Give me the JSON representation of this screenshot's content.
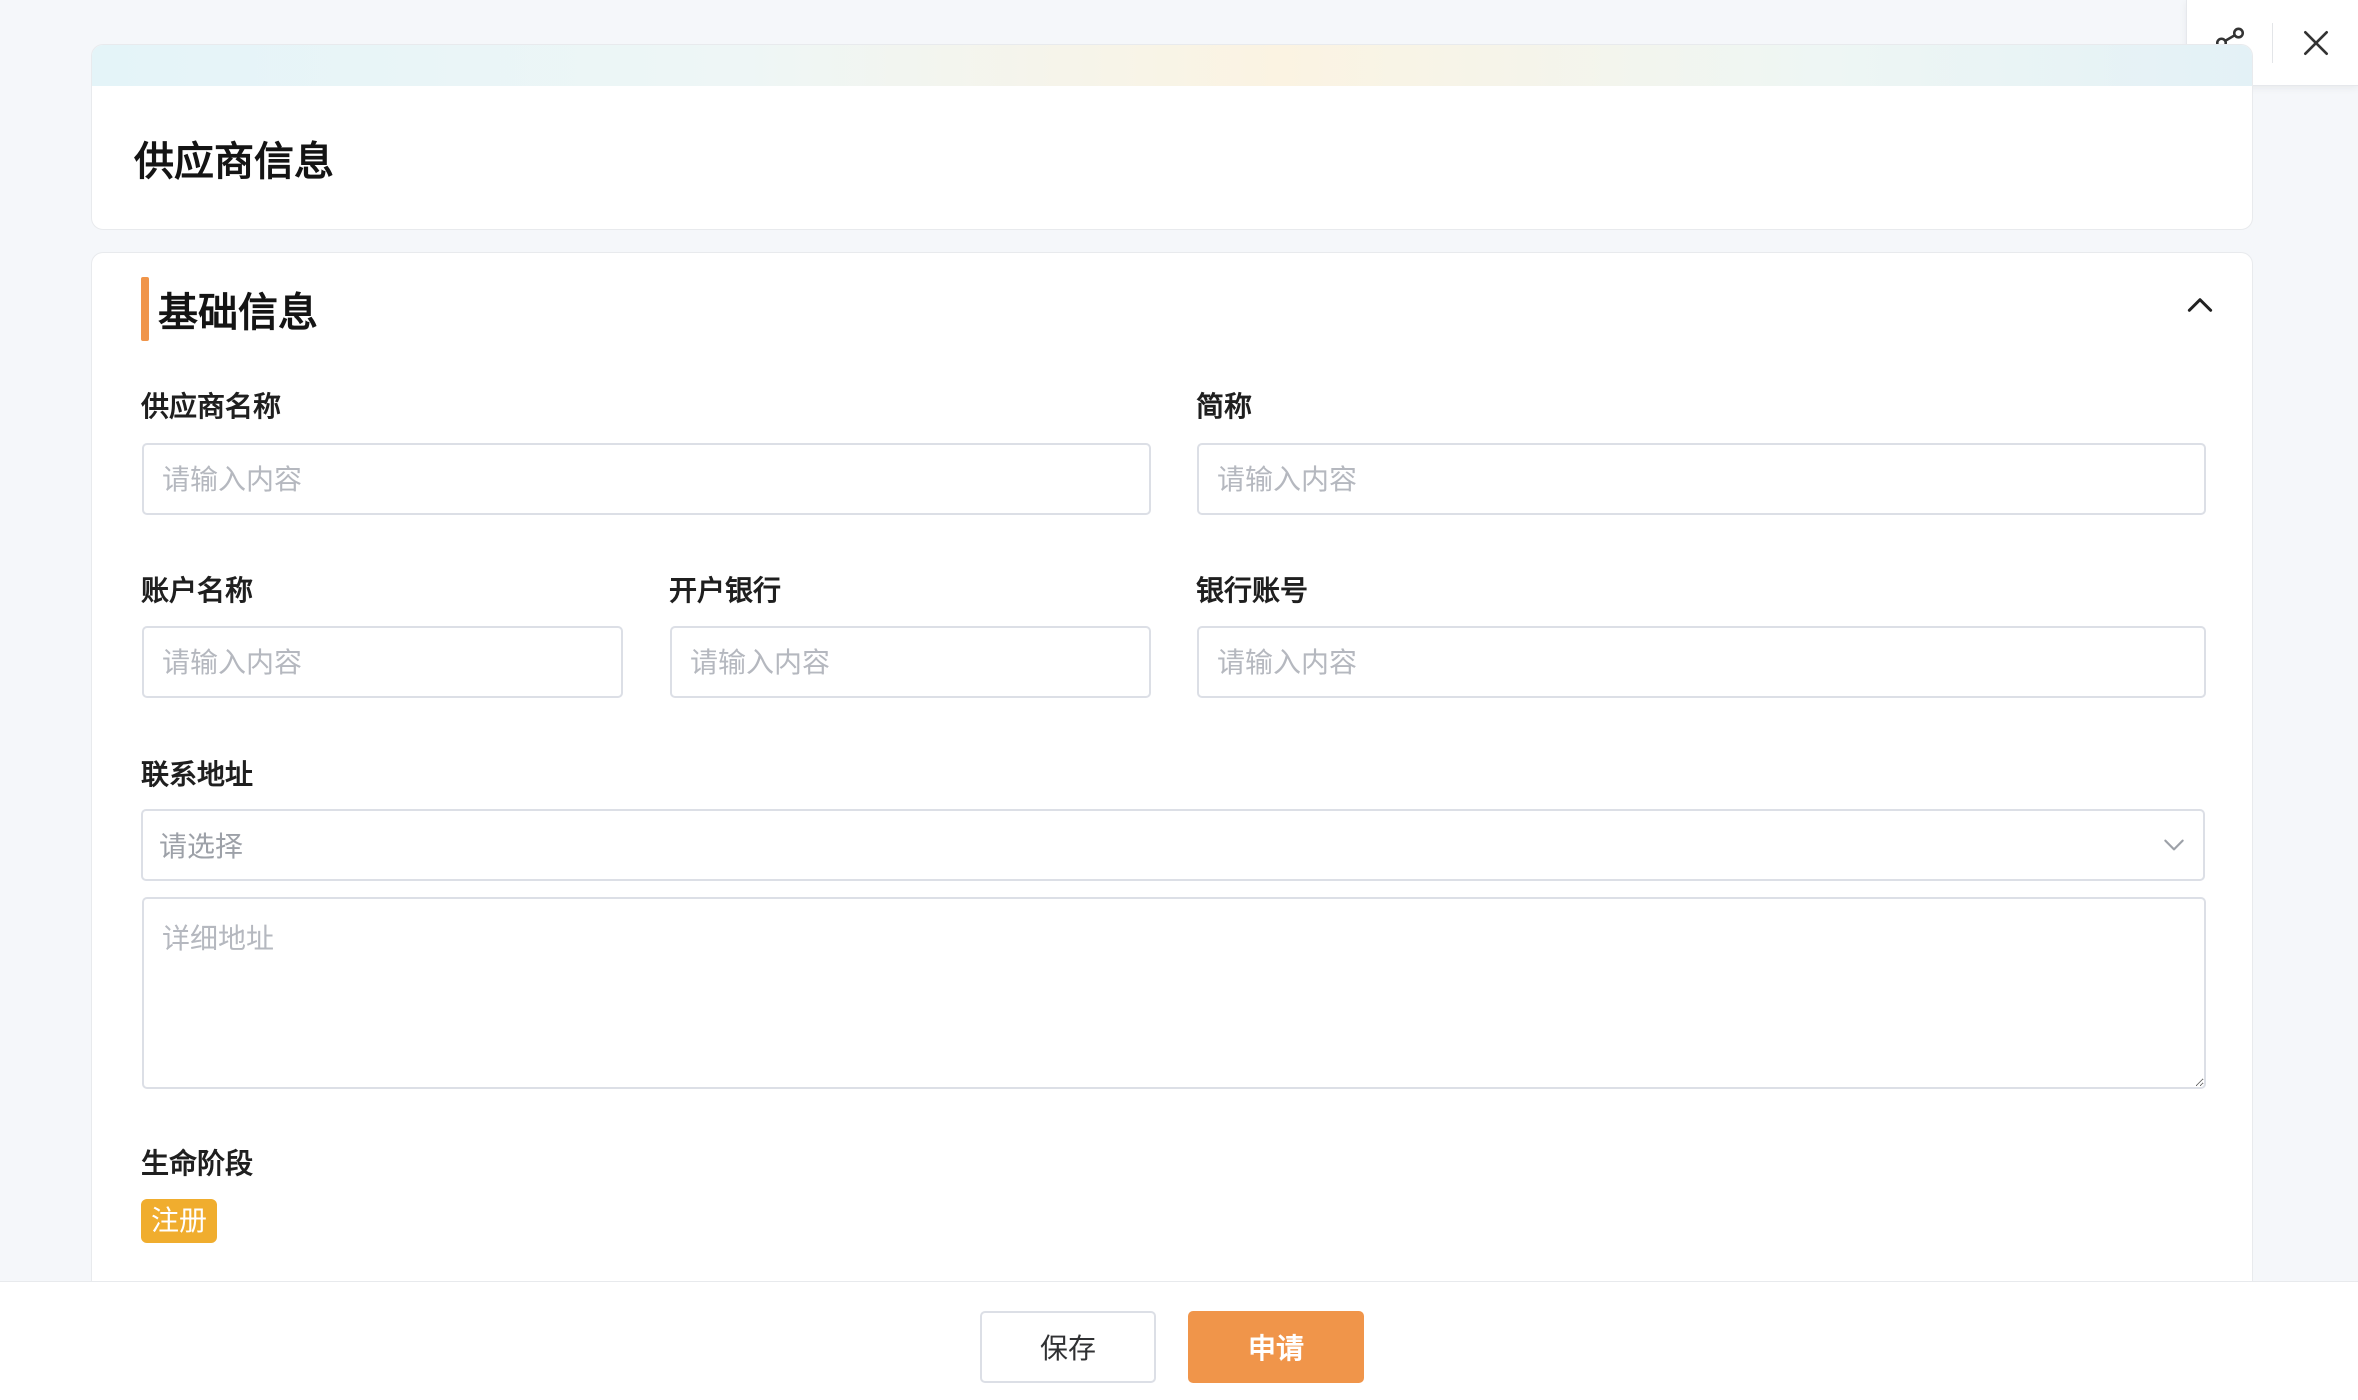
{
  "header": {
    "title": "供应商信息"
  },
  "tools": {
    "share_icon": "share-icon",
    "close_icon": "close-icon"
  },
  "section": {
    "title": "基础信息",
    "collapse_icon": "chevron-up-icon"
  },
  "fields": {
    "supplier_name": {
      "label": "供应商名称",
      "placeholder": "请输入内容",
      "value": ""
    },
    "short_name": {
      "label": "简称",
      "placeholder": "请输入内容",
      "value": ""
    },
    "account_name": {
      "label": "账户名称",
      "placeholder": "请输入内容",
      "value": ""
    },
    "bank": {
      "label": "开户银行",
      "placeholder": "请输入内容",
      "value": ""
    },
    "bank_account": {
      "label": "银行账号",
      "placeholder": "请输入内容",
      "value": ""
    },
    "address": {
      "label": "联系地址",
      "select_placeholder": "请选择",
      "detail_placeholder": "详细地址"
    },
    "lifecycle": {
      "label": "生命阶段",
      "tag": "注册"
    }
  },
  "footer": {
    "save_label": "保存",
    "apply_label": "申请"
  },
  "colors": {
    "accent": "#f0954a",
    "tag": "#f0ad2e",
    "border": "#dcdfe6"
  }
}
